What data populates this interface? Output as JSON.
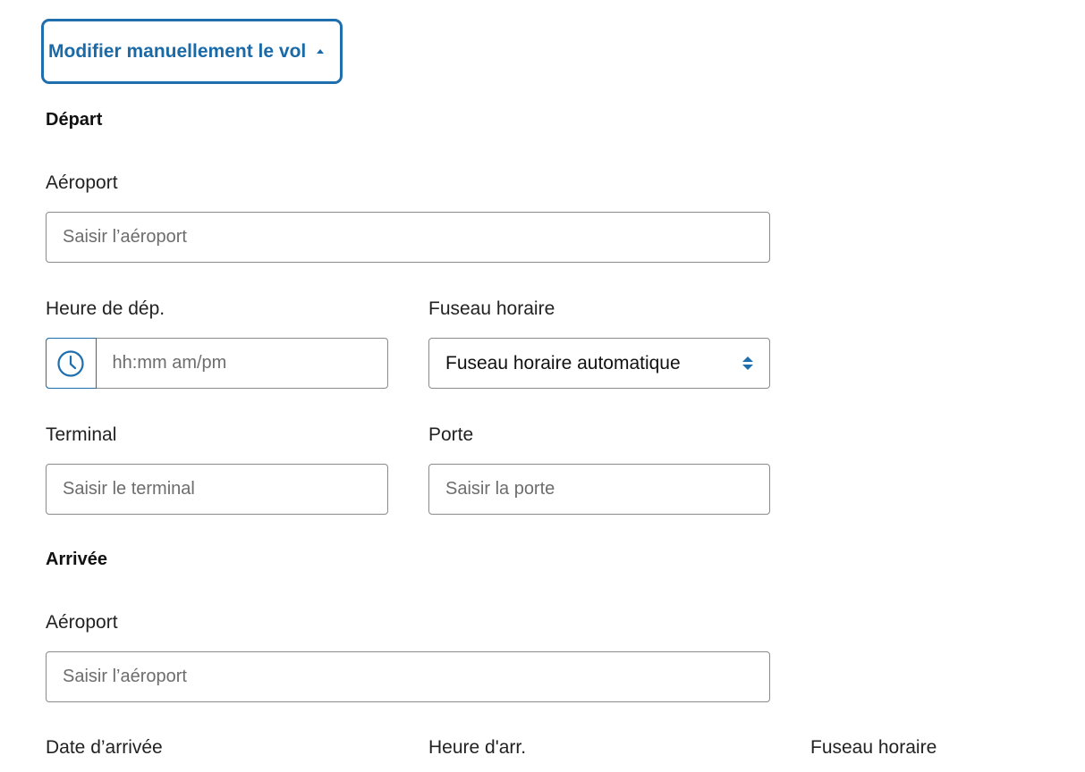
{
  "toggle": {
    "label": "Modifier manuellement le vol"
  },
  "departure": {
    "title": "Départ",
    "airport": {
      "label": "Aéroport",
      "placeholder": "Saisir l’aéroport"
    },
    "time": {
      "label": "Heure de dép.",
      "placeholder": "hh:mm am/pm"
    },
    "timezone": {
      "label": "Fuseau horaire",
      "value": "Fuseau horaire automatique"
    },
    "terminal": {
      "label": "Terminal",
      "placeholder": "Saisir le terminal"
    },
    "gate": {
      "label": "Porte",
      "placeholder": "Saisir la porte"
    }
  },
  "arrival": {
    "title": "Arrivée",
    "airport": {
      "label": "Aéroport",
      "placeholder": "Saisir l’aéroport"
    },
    "date": {
      "label": "Date d’arrivée"
    },
    "time": {
      "label": "Heure d'arr."
    },
    "timezone": {
      "label": "Fuseau horaire"
    }
  },
  "colors": {
    "accent": "#1f6fae",
    "border": "#8a8a8a"
  },
  "icons": {
    "clock": "clock-icon",
    "caret": "caret-up-icon",
    "select": "sort-arrows-icon"
  }
}
